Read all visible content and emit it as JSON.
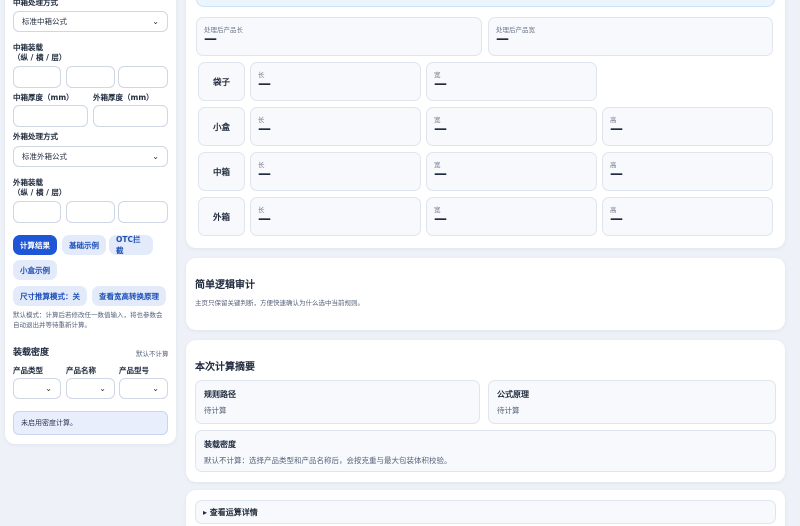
{
  "left": {
    "inner_method_label": "中箱处理方式",
    "inner_method_value": "标准中箱公式",
    "inner_pack_label": "中箱装载",
    "inner_pack_sub": "（纵 / 横 / 层）",
    "inner_thick_label": "中箱厚度（mm）",
    "outer_thick_label": "外箱厚度（mm）",
    "outer_method_label": "外箱处理方式",
    "outer_method_value": "标准外箱公式",
    "outer_pack_label": "外箱装载",
    "outer_pack_sub": "（纵 / 横 / 层）",
    "buttons": {
      "calc": "计算结果",
      "basic": "基础示例",
      "otc": "OTC拦截",
      "smallbox": "小盒示例",
      "size_mode": "尺寸推算模式：关",
      "view_rule": "查看宽高转换原理"
    },
    "hint": "默认模式：计算后若修改任一数值输入，将也参数会自动退出并等待重新计算。",
    "density_title": "装载密度",
    "density_default": "默认不计算",
    "product_type_label": "产品类型",
    "product_name_label": "产品名称",
    "product_model_label": "产品型号",
    "density_note": "未启用密度计算。"
  },
  "result": {
    "processed_length_caption": "处理后产品长",
    "processed_length_value": "—",
    "processed_width_caption": "处理后产品宽",
    "processed_width_value": "—",
    "rows": [
      {
        "name": "袋子",
        "l_cap": "长",
        "l_val": "—",
        "w_cap": "宽",
        "w_val": "—"
      },
      {
        "name": "小盒",
        "l_cap": "长",
        "l_val": "—",
        "w_cap": "宽",
        "w_val": "—",
        "h_cap": "高",
        "h_val": "—"
      },
      {
        "name": "中箱",
        "l_cap": "长",
        "l_val": "—",
        "w_cap": "宽",
        "w_val": "—",
        "h_cap": "高",
        "h_val": "—"
      },
      {
        "name": "外箱",
        "l_cap": "长",
        "l_val": "—",
        "w_cap": "宽",
        "w_val": "—",
        "h_cap": "高",
        "h_val": "—"
      }
    ]
  },
  "audit": {
    "title": "简单逻辑审计",
    "desc": "主页只保留关键判断，方便快速确认为什么选中当前规则。"
  },
  "summary": {
    "title": "本次计算摘要",
    "rule_path_title": "规则路径",
    "rule_path_value": "待计算",
    "formula_title": "公式原理",
    "formula_value": "待计算",
    "density_title": "装载密度",
    "density_value": "默认不计算：选择产品类型和产品名称后，会按克重与最大包装体积校验。"
  },
  "details": {
    "label": "▸ 查看运算详情"
  }
}
